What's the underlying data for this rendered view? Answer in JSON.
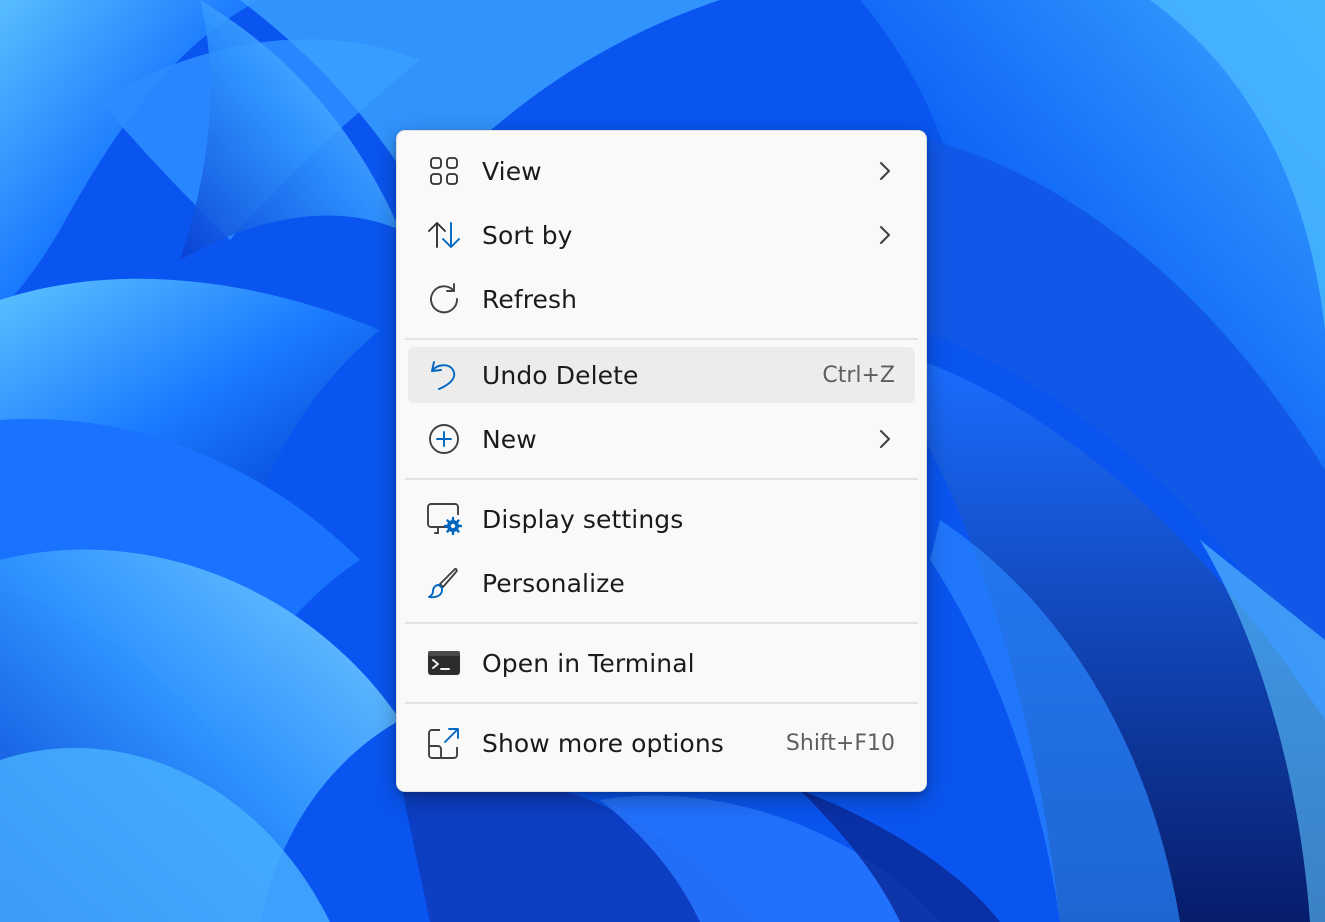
{
  "desktop": {
    "wallpaper": "windows-11-bloom",
    "colors": {
      "base": "#0a5cff",
      "light": "#4fb6ff",
      "dark": "#0a2a8f"
    }
  },
  "context_menu": {
    "items": [
      {
        "id": "view",
        "label": "View",
        "icon": "view-grid-icon",
        "submenu": true
      },
      {
        "id": "sort-by",
        "label": "Sort by",
        "icon": "sort-arrows-icon",
        "submenu": true
      },
      {
        "id": "refresh",
        "label": "Refresh",
        "icon": "refresh-icon",
        "submenu": false
      },
      {
        "id": "undo-delete",
        "label": "Undo Delete",
        "icon": "undo-icon",
        "shortcut": "Ctrl+Z",
        "highlighted": true
      },
      {
        "id": "new",
        "label": "New",
        "icon": "add-circle-icon",
        "submenu": true
      },
      {
        "id": "display-settings",
        "label": "Display settings",
        "icon": "display-settings-icon"
      },
      {
        "id": "personalize",
        "label": "Personalize",
        "icon": "paintbrush-icon"
      },
      {
        "id": "open-in-terminal",
        "label": "Open in Terminal",
        "icon": "terminal-icon"
      },
      {
        "id": "show-more-options",
        "label": "Show more options",
        "icon": "show-more-options-icon",
        "shortcut": "Shift+F10"
      }
    ],
    "accent_color": "#0067c0",
    "hover_color": "#ececec",
    "background": "#f9f9f9"
  }
}
